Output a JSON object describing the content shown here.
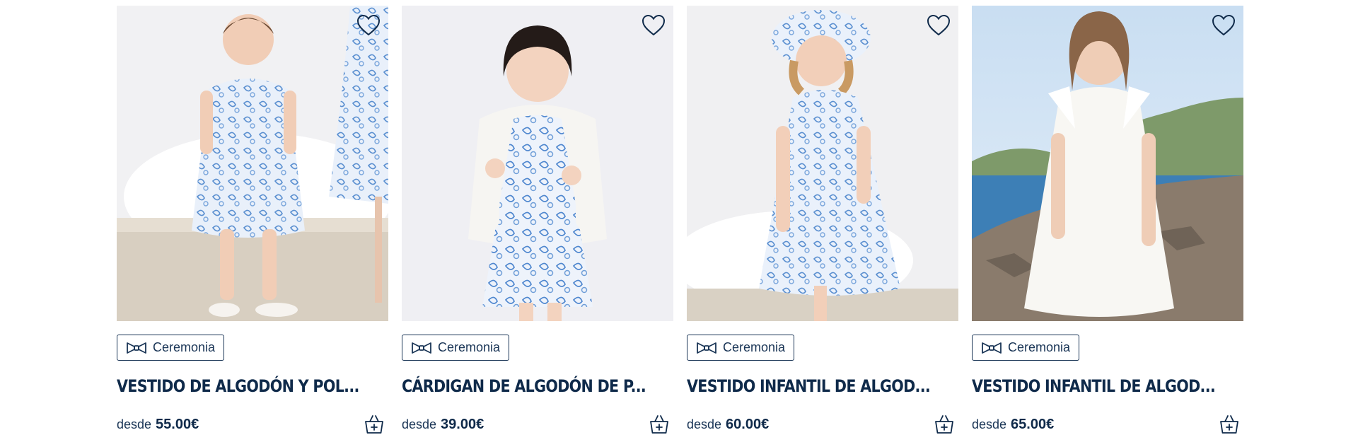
{
  "products": [
    {
      "tag": "Ceremonia",
      "title": "VESTIDO DE ALGODÓN Y POL...",
      "price_prefix": "desde",
      "price": "55.00€",
      "image": "toddler-in-blue-floral-dress"
    },
    {
      "tag": "Ceremonia",
      "title": "CÁRDIGAN DE ALGODÓN DE P...",
      "price_prefix": "desde",
      "price": "39.00€",
      "image": "toddler-in-white-cardigan-and-floral-dress"
    },
    {
      "tag": "Ceremonia",
      "title": "VESTIDO INFANTIL DE ALGOD...",
      "price_prefix": "desde",
      "price": "60.00€",
      "image": "girl-in-bucket-hat-and-floral-dress"
    },
    {
      "tag": "Ceremonia",
      "title": "VESTIDO INFANTIL DE ALGOD...",
      "price_prefix": "desde",
      "price": "65.00€",
      "image": "girl-in-white-dress-by-the-sea"
    }
  ],
  "icons": {
    "favorite": "heart-outline-icon",
    "tag": "bow-tie-icon",
    "cart": "basket-plus-icon"
  },
  "colors": {
    "brand_navy": "#0f2a4a",
    "dress_blue": "#5a8fd0"
  }
}
